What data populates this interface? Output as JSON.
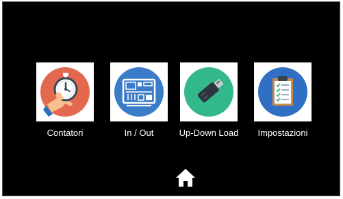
{
  "screen": {
    "background": "#000000"
  },
  "menu": {
    "items": [
      {
        "label": "Contatori",
        "icon": "stopwatch-in-hand-icon",
        "circle_color": "#e2694f"
      },
      {
        "label": "In / Out",
        "icon": "circuit-board-icon",
        "circle_color": "#3b7cc9"
      },
      {
        "label": "Up-Down Load",
        "icon": "usb-drive-icon",
        "circle_color": "#33b88b"
      },
      {
        "label": "Impostazioni",
        "icon": "clipboard-checklist-icon",
        "circle_color": "#2f6fc4"
      }
    ]
  },
  "footer": {
    "home_icon": "home-icon",
    "home_color": "#ffffff"
  }
}
